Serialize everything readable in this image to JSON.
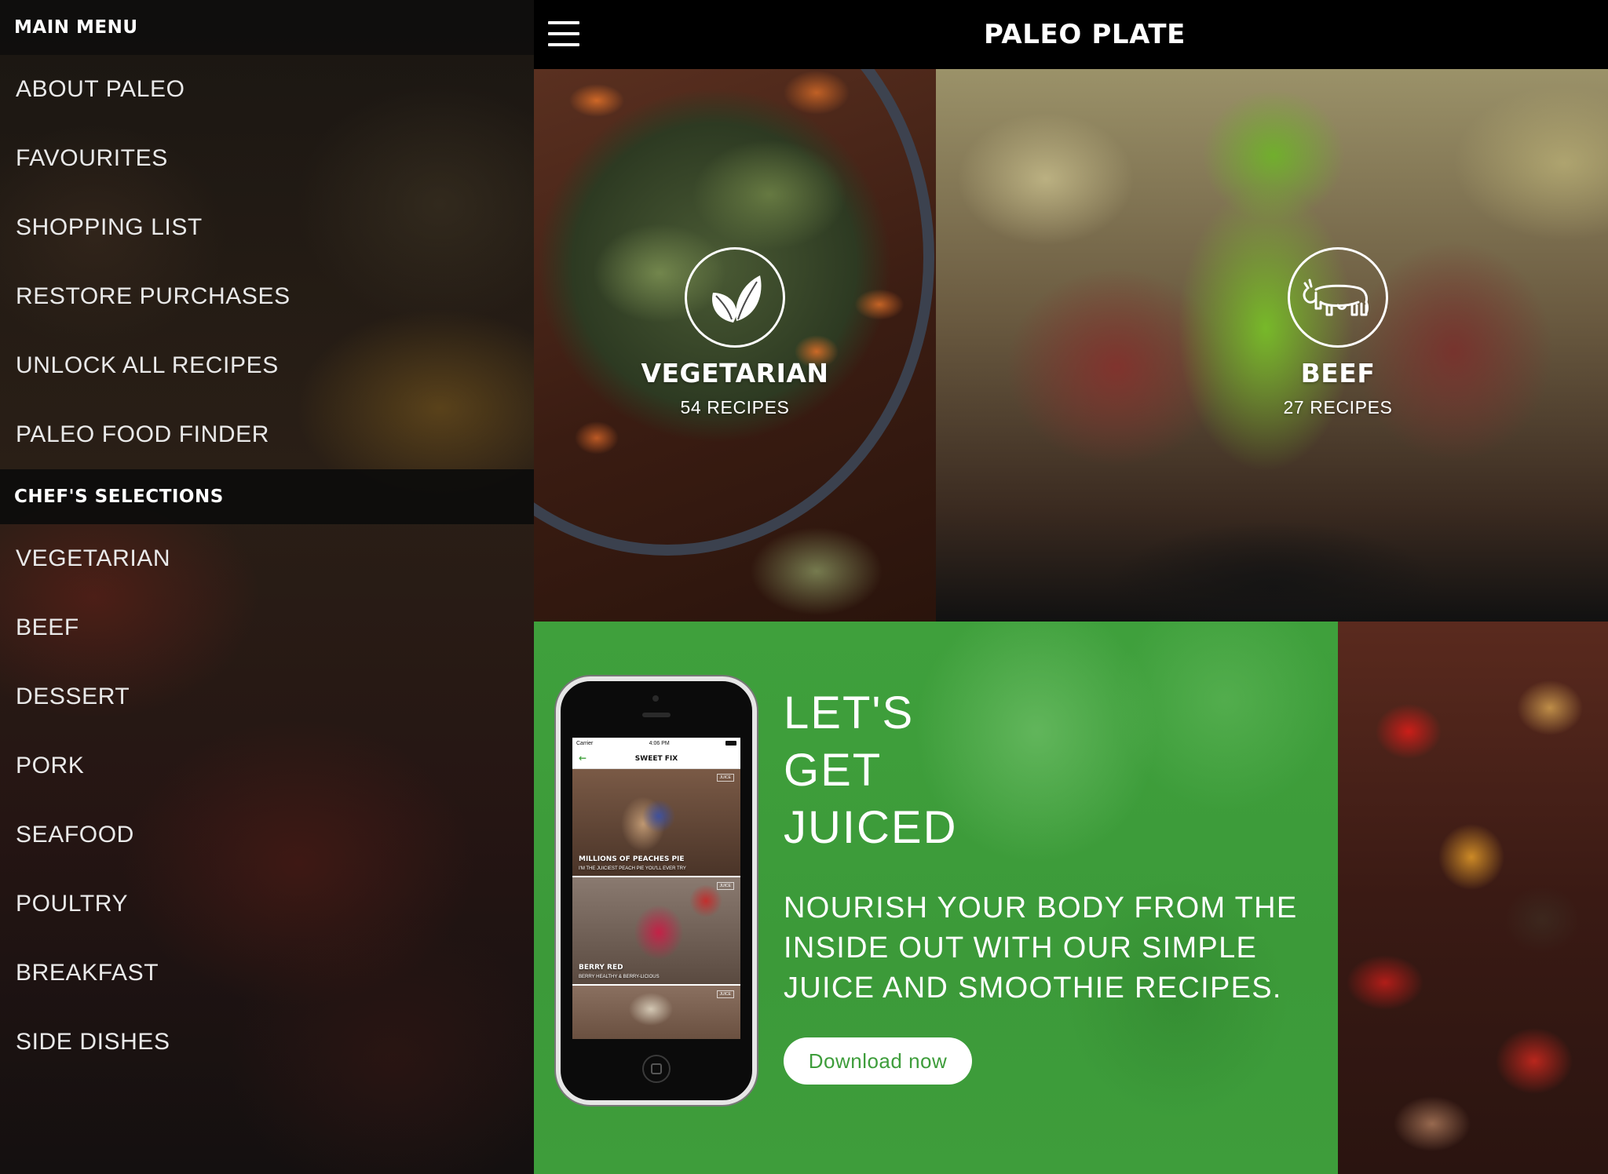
{
  "sidebar": {
    "main_menu_header": "MAIN MENU",
    "main_items": [
      {
        "label": "ABOUT PALEO"
      },
      {
        "label": "FAVOURITES"
      },
      {
        "label": "SHOPPING LIST"
      },
      {
        "label": "RESTORE PURCHASES"
      },
      {
        "label": "UNLOCK ALL RECIPES"
      },
      {
        "label": "PALEO FOOD FINDER"
      }
    ],
    "chef_header": "CHEF'S SELECTIONS",
    "chef_items": [
      {
        "label": "VEGETARIAN"
      },
      {
        "label": "BEEF"
      },
      {
        "label": "DESSERT"
      },
      {
        "label": "PORK"
      },
      {
        "label": "SEAFOOD"
      },
      {
        "label": "POULTRY"
      },
      {
        "label": "BREAKFAST"
      },
      {
        "label": "SIDE DISHES"
      }
    ]
  },
  "header": {
    "title": "PALEO PLATE",
    "menu_icon": "hamburger-icon"
  },
  "tiles": {
    "vegetarian": {
      "name": "VEGETARIAN",
      "count": "54 RECIPES",
      "icon": "leaf-icon"
    },
    "beef": {
      "name": "BEEF",
      "count": "27 RECIPES",
      "icon": "cow-icon"
    }
  },
  "promo": {
    "headline": [
      "LET'S",
      "GET",
      "JUICED"
    ],
    "body": "NOURISH YOUR BODY FROM THE INSIDE OUT WITH OUR SIMPLE JUICE AND SMOOTHIE RECIPES.",
    "button_label": "Download now",
    "accent_color": "#3e9d3b",
    "phone": {
      "carrier": "Carrier",
      "time": "4:06 PM",
      "nav_title": "SWEET FIX",
      "cards": [
        {
          "badge": "JUICE",
          "title": "MILLIONS OF PEACHES PIE",
          "subtitle": "I'M THE JUICIEST PEACH PIE YOU'LL EVER TRY"
        },
        {
          "badge": "JUICE",
          "title": "BERRY RED",
          "subtitle": "BERRY HEALTHY & BERRY-LICIOUS"
        },
        {
          "badge": "JUICE"
        }
      ]
    }
  }
}
